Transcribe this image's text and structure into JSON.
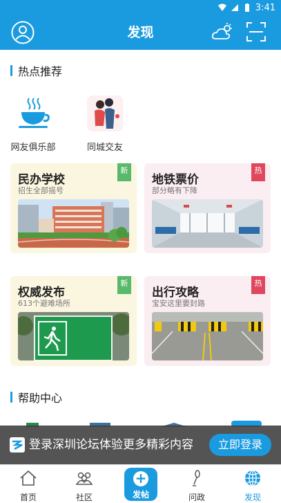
{
  "status_bar": {
    "time": "3:41"
  },
  "app_bar": {
    "title": "发现"
  },
  "hot_section": {
    "title": "热点推荐"
  },
  "shortcuts": [
    {
      "label": "网友俱乐部",
      "icon": "coffee-cup-icon"
    },
    {
      "label": "同城交友",
      "icon": "couple-icon"
    }
  ],
  "cards": [
    {
      "title": "民办学校",
      "subtitle": "招生全部摇号",
      "tag": "新"
    },
    {
      "title": "地铁票价",
      "subtitle": "部分略有下降",
      "tag": "热"
    },
    {
      "title": "权威发布",
      "subtitle": "613个避难场所",
      "tag": "新"
    },
    {
      "title": "出行攻略",
      "subtitle": "宝安这里要封路",
      "tag": "热"
    }
  ],
  "help_section": {
    "title": "帮助中心"
  },
  "login_banner": {
    "message": "登录深圳论坛体验更多精彩内容",
    "button": "立即登录"
  },
  "tabs": [
    {
      "label": "首页",
      "icon": "home-icon"
    },
    {
      "label": "社区",
      "icon": "community-icon"
    },
    {
      "label": "发帖",
      "icon": "plus-icon"
    },
    {
      "label": "问政",
      "icon": "microphone-icon"
    },
    {
      "label": "发现",
      "icon": "globe-icon"
    }
  ],
  "colors": {
    "primary": "#1a9be0",
    "new_tag": "#59b96a",
    "hot_tag": "#e0475f"
  }
}
